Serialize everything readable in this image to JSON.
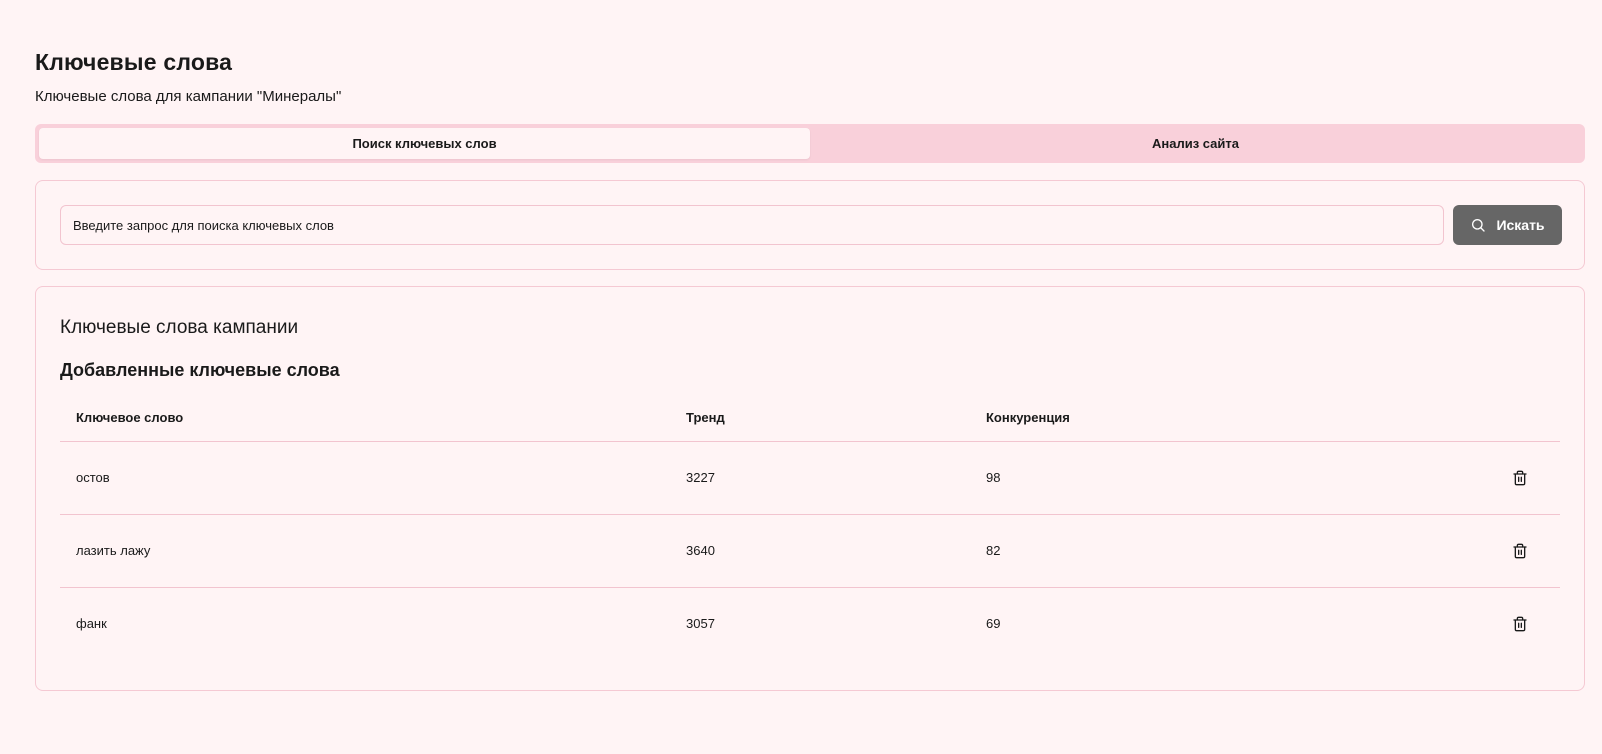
{
  "page": {
    "title": "Ключевые слова",
    "subtitle": "Ключевые слова для кампании \"Минералы\""
  },
  "tabs": [
    {
      "label": "Поиск ключевых слов",
      "active": true
    },
    {
      "label": "Анализ сайта",
      "active": false
    }
  ],
  "search": {
    "placeholder": "Введите запрос для поиска ключевых слов",
    "value": "",
    "button_label": "Искать",
    "button_icon": "search-icon"
  },
  "keywords": {
    "section_title": "Ключевые слова кампании",
    "subsection_title": "Добавленные ключевые слова",
    "columns": [
      "Ключевое слово",
      "Тренд",
      "Конкуренция"
    ],
    "rows": [
      {
        "keyword": "остов",
        "trend": "3227",
        "competition": "98",
        "action_icon": "trash-icon"
      },
      {
        "keyword": "лазить лажу",
        "trend": "3640",
        "competition": "82",
        "action_icon": "trash-icon"
      },
      {
        "keyword": "фанк",
        "trend": "3057",
        "competition": "69",
        "action_icon": "trash-icon"
      }
    ]
  },
  "colors": {
    "background": "#fff4f5",
    "tabs_bg": "#f9d0da",
    "border": "#f2c4cf",
    "button_bg": "#666666"
  }
}
